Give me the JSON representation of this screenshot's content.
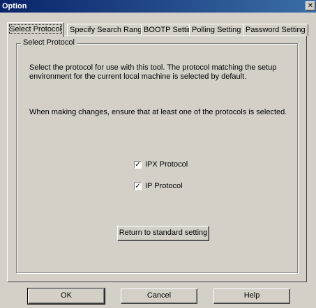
{
  "window": {
    "title": "Option",
    "close_glyph": "✕"
  },
  "tabs": [
    {
      "label": "Select Protocol",
      "active": true
    },
    {
      "label": "Specify Search Range",
      "active": false
    },
    {
      "label": "BOOTP Setting",
      "active": false
    },
    {
      "label": "Polling Setting",
      "active": false
    },
    {
      "label": "Password Setting",
      "active": false
    }
  ],
  "group": {
    "label": "Select Protocol",
    "description": "Select the protocol for use with this tool. The protocol matching the setup environment for the current local machine is selected by default.",
    "note": "When making changes, ensure that at least one of the protocols is selected.",
    "checkboxes": [
      {
        "label": "IPX Protocol",
        "checked": true,
        "mark": "✓"
      },
      {
        "label": "IP Protocol",
        "checked": true,
        "mark": "✓"
      }
    ],
    "reset_button": "Return to standard setting"
  },
  "buttons": {
    "ok": "OK",
    "cancel": "Cancel",
    "help": "Help"
  }
}
